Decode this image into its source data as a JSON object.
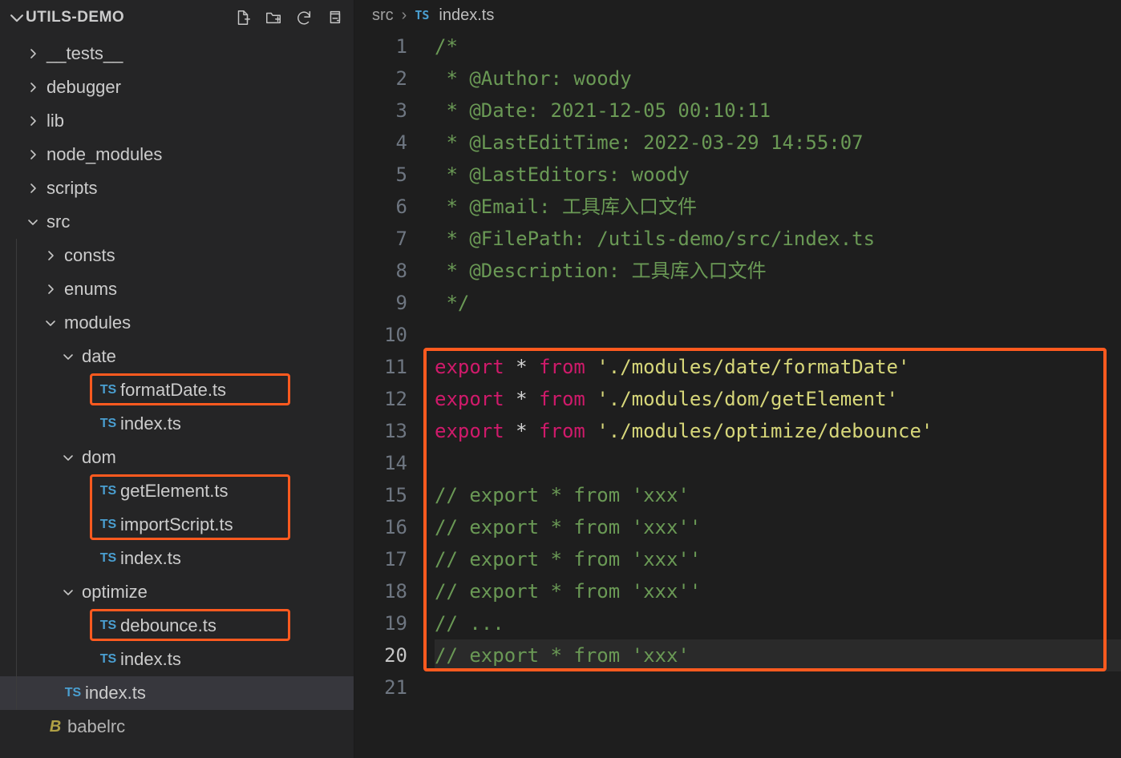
{
  "sidebar": {
    "title": "UTILS-DEMO",
    "actions": [
      "new-file-icon",
      "new-folder-icon",
      "refresh-icon",
      "collapse-all-icon"
    ]
  },
  "tree": [
    {
      "depth": 0,
      "twisty": "right",
      "icon": "",
      "label": "__tests__",
      "interact": true
    },
    {
      "depth": 0,
      "twisty": "right",
      "icon": "",
      "label": "debugger",
      "interact": true
    },
    {
      "depth": 0,
      "twisty": "right",
      "icon": "",
      "label": "lib",
      "interact": true
    },
    {
      "depth": 0,
      "twisty": "right",
      "icon": "",
      "label": "node_modules",
      "interact": true
    },
    {
      "depth": 0,
      "twisty": "right",
      "icon": "",
      "label": "scripts",
      "interact": true
    },
    {
      "depth": 0,
      "twisty": "down",
      "icon": "",
      "label": "src",
      "interact": true
    },
    {
      "depth": 1,
      "twisty": "right",
      "icon": "",
      "label": "consts",
      "interact": true
    },
    {
      "depth": 1,
      "twisty": "right",
      "icon": "",
      "label": "enums",
      "interact": true
    },
    {
      "depth": 1,
      "twisty": "down",
      "icon": "",
      "label": "modules",
      "interact": true
    },
    {
      "depth": 2,
      "twisty": "down",
      "icon": "",
      "label": "date",
      "interact": true
    },
    {
      "depth": 3,
      "twisty": "none",
      "icon": "ts",
      "label": "formatDate.ts",
      "interact": true,
      "boxStart": true,
      "boxH": 1
    },
    {
      "depth": 3,
      "twisty": "none",
      "icon": "ts",
      "label": "index.ts",
      "interact": true
    },
    {
      "depth": 2,
      "twisty": "down",
      "icon": "",
      "label": "dom",
      "interact": true
    },
    {
      "depth": 3,
      "twisty": "none",
      "icon": "ts",
      "label": "getElement.ts",
      "interact": true,
      "boxStart": true,
      "boxH": 2
    },
    {
      "depth": 3,
      "twisty": "none",
      "icon": "ts",
      "label": "importScript.ts",
      "interact": true
    },
    {
      "depth": 3,
      "twisty": "none",
      "icon": "ts",
      "label": "index.ts",
      "interact": true
    },
    {
      "depth": 2,
      "twisty": "down",
      "icon": "",
      "label": "optimize",
      "interact": true
    },
    {
      "depth": 3,
      "twisty": "none",
      "icon": "ts",
      "label": "debounce.ts",
      "interact": true,
      "boxStart": true,
      "boxH": 1
    },
    {
      "depth": 3,
      "twisty": "none",
      "icon": "ts",
      "label": "index.ts",
      "interact": true
    },
    {
      "depth": 1,
      "twisty": "none",
      "icon": "ts",
      "label": "index.ts",
      "interact": true,
      "selected": true
    },
    {
      "depth": 0,
      "twisty": "none",
      "icon": "babel",
      "label": "babelrc",
      "interact": true,
      "cut": true
    }
  ],
  "breadcrumbs": {
    "seg1": "src",
    "tsTag": "TS",
    "file": "index.ts"
  },
  "code": {
    "currentLine": 20,
    "hlStart": 11,
    "hlEnd": 20,
    "lines": [
      {
        "n": 1,
        "t": [
          [
            "c-comment",
            "/*"
          ]
        ]
      },
      {
        "n": 2,
        "t": [
          [
            "c-comment",
            " * @Author: woody"
          ]
        ]
      },
      {
        "n": 3,
        "t": [
          [
            "c-comment",
            " * @Date: 2021-12-05 00:10:11"
          ]
        ]
      },
      {
        "n": 4,
        "t": [
          [
            "c-comment",
            " * @LastEditTime: 2022-03-29 14:55:07"
          ]
        ]
      },
      {
        "n": 5,
        "t": [
          [
            "c-comment",
            " * @LastEditors: woody"
          ]
        ]
      },
      {
        "n": 6,
        "t": [
          [
            "c-comment",
            " * @Email: 工具库入口文件"
          ]
        ]
      },
      {
        "n": 7,
        "t": [
          [
            "c-comment",
            " * @FilePath: /utils-demo/src/index.ts"
          ]
        ]
      },
      {
        "n": 8,
        "t": [
          [
            "c-comment",
            " * @Description: 工具库入口文件"
          ]
        ]
      },
      {
        "n": 9,
        "t": [
          [
            "c-comment",
            " */"
          ]
        ]
      },
      {
        "n": 10,
        "t": [
          [
            "",
            ""
          ]
        ]
      },
      {
        "n": 11,
        "t": [
          [
            "c-kw",
            "export"
          ],
          [
            "",
            " "
          ],
          [
            "c-op",
            "*"
          ],
          [
            "",
            " "
          ],
          [
            "c-from",
            "from"
          ],
          [
            "",
            " "
          ],
          [
            "c-str",
            "'./modules/date/formatDate'"
          ]
        ]
      },
      {
        "n": 12,
        "t": [
          [
            "c-kw",
            "export"
          ],
          [
            "",
            " "
          ],
          [
            "c-op",
            "*"
          ],
          [
            "",
            " "
          ],
          [
            "c-from",
            "from"
          ],
          [
            "",
            " "
          ],
          [
            "c-str",
            "'./modules/dom/getElement'"
          ]
        ]
      },
      {
        "n": 13,
        "t": [
          [
            "c-kw",
            "export"
          ],
          [
            "",
            " "
          ],
          [
            "c-op",
            "*"
          ],
          [
            "",
            " "
          ],
          [
            "c-from",
            "from"
          ],
          [
            "",
            " "
          ],
          [
            "c-str",
            "'./modules/optimize/debounce'"
          ]
        ]
      },
      {
        "n": 14,
        "t": [
          [
            "",
            ""
          ]
        ]
      },
      {
        "n": 15,
        "t": [
          [
            "c-comment",
            "// export * from 'xxx'"
          ]
        ]
      },
      {
        "n": 16,
        "t": [
          [
            "c-comment",
            "// export * from 'xxx''"
          ]
        ]
      },
      {
        "n": 17,
        "t": [
          [
            "c-comment",
            "// export * from 'xxx''"
          ]
        ]
      },
      {
        "n": 18,
        "t": [
          [
            "c-comment",
            "// export * from 'xxx''"
          ]
        ]
      },
      {
        "n": 19,
        "t": [
          [
            "c-comment",
            "// ..."
          ]
        ]
      },
      {
        "n": 20,
        "t": [
          [
            "c-comment",
            "// export * from 'xxx'"
          ]
        ]
      },
      {
        "n": 21,
        "t": [
          [
            "",
            ""
          ]
        ]
      }
    ]
  }
}
